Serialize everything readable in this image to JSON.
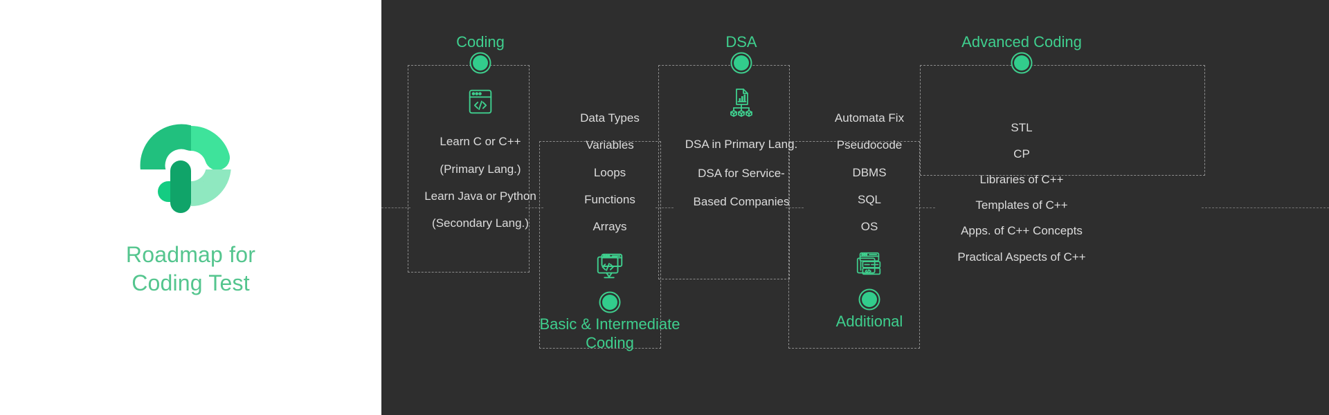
{
  "brand": {
    "logo_icon": "phoenix-p-logo",
    "title_line1": "Roadmap for",
    "title_line2": "Coding Test",
    "accent_color": "#54c58e"
  },
  "theme": {
    "panel_background": "#2e2e2e",
    "left_background": "#ffffff",
    "node_color": "#32cd8c",
    "heading_color": "#3fcf8e",
    "item_text_color": "#dcdcdc",
    "dash_color": "#8d8d8d"
  },
  "roadmap": {
    "columns": [
      {
        "id": "coding",
        "label": "Coding",
        "label_position": "top",
        "icon": "browser-code-icon",
        "icon_position": "top",
        "items": [
          "Learn C or C++",
          "(Primary Lang.)",
          "Learn Java or Python",
          "(Secondary Lang.)"
        ]
      },
      {
        "id": "basic-intermediate-coding",
        "label": "Basic & Intermediate Coding",
        "label_line1": "Basic & Intermediate",
        "label_line2": "Coding",
        "label_position": "bottom",
        "icon": "monitor-code-icon",
        "icon_position": "bottom",
        "items": [
          "Data Types",
          "Variables",
          "Loops",
          "Functions",
          "Arrays"
        ]
      },
      {
        "id": "dsa",
        "label": "DSA",
        "label_position": "top",
        "icon": "data-structure-chart-icon",
        "icon_position": "top",
        "items": [
          "DSA in Primary Lang.",
          "DSA for Service-",
          "Based Companies"
        ]
      },
      {
        "id": "additional",
        "label": "Additional",
        "label_position": "bottom",
        "icon": "stacked-code-windows-icon",
        "icon_position": "bottom",
        "items": [
          "Automata Fix",
          "Pseudocode",
          "DBMS",
          "SQL",
          "OS"
        ]
      },
      {
        "id": "advanced-coding",
        "label": "Advanced Coding",
        "label_position": "top",
        "icon": "none",
        "icon_position": "none",
        "items": [
          "STL",
          "CP",
          "Libraries of C++",
          "Templates of C++",
          "Apps. of C++ Concepts",
          "Practical Aspects of C++"
        ]
      }
    ]
  }
}
